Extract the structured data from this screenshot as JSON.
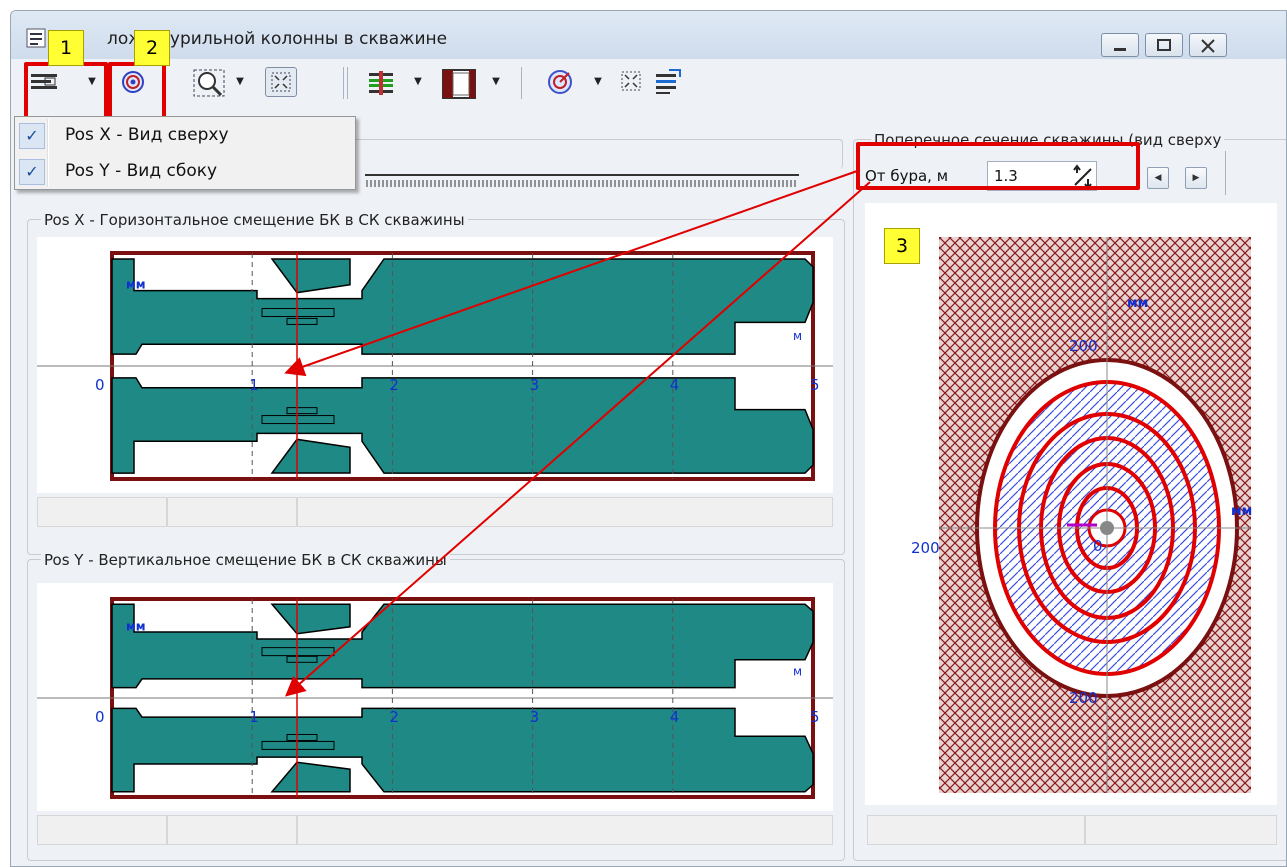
{
  "window": {
    "title": "Положение бурильной колонны в скважине",
    "title_visible": "ложе бурильной колонны в скважине",
    "minimize": "▭",
    "maximize": "□",
    "close": "✕"
  },
  "callouts": [
    "1",
    "2",
    "3"
  ],
  "menu": {
    "items": [
      {
        "label": "Pos X - Вид сверху",
        "checked": true
      },
      {
        "label": "Pos Y - Вид сбоку",
        "checked": true
      }
    ]
  },
  "panels": {
    "posx": {
      "title": "Pos X - Горизонтальное смещение БК в СК скважины"
    },
    "posy": {
      "title": "Pos Y - Вертикальное смещение БК в СК скважины"
    },
    "cross": {
      "title": "Поперечное сечение скважины (вид сверху"
    }
  },
  "longitudinal_axis": {
    "unit_y": "мм",
    "unit_x": "м",
    "ticks": [
      "0",
      "1",
      "2",
      "3",
      "4",
      "5"
    ]
  },
  "cross_section": {
    "distance_label": "От бура, м",
    "distance_value": "1.3",
    "unit": "мм",
    "tick_top": "200",
    "tick_left": "200",
    "tick_bottom": "200",
    "center": "0",
    "unit_right": "мм"
  },
  "colors": {
    "accent_red": "#e00000",
    "pipe_teal": "#1f8a85",
    "wall_dark_red": "#7b1010",
    "callout_yellow": "#ffff33",
    "hatch_blue": "#3a4fe0"
  }
}
